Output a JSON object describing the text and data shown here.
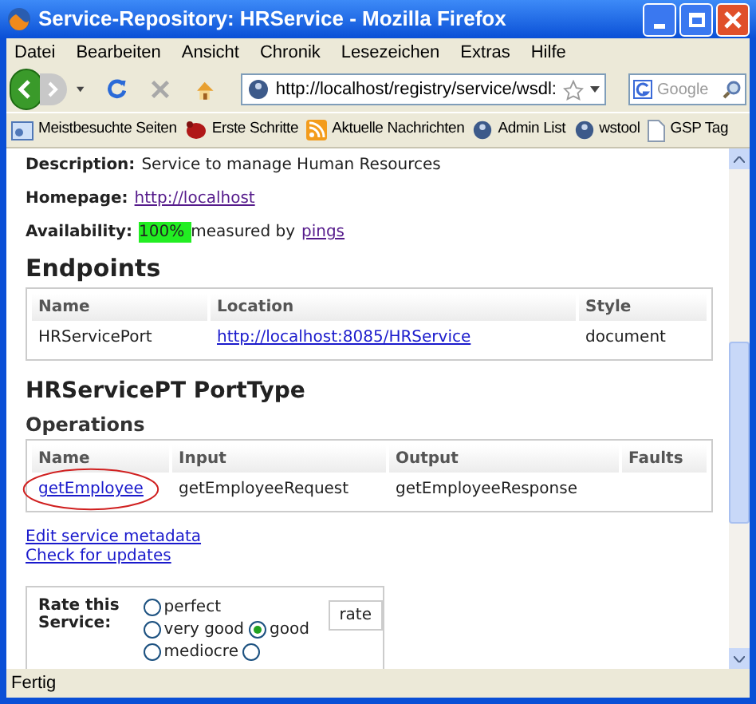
{
  "window": {
    "title": "Service-Repository: HRService - Mozilla Firefox"
  },
  "menu": [
    "Datei",
    "Bearbeiten",
    "Ansicht",
    "Chronik",
    "Lesezeichen",
    "Extras",
    "Hilfe"
  ],
  "toolbar": {
    "url": "http://localhost/registry/service/wsdl:",
    "search_placeholder": "Google"
  },
  "bookmarks": [
    {
      "label": "Meistbesuchte Seiten",
      "kind": "folder"
    },
    {
      "label": "Erste Schritte",
      "kind": "bug"
    },
    {
      "label": "Aktuelle Nachrichten",
      "kind": "feed"
    },
    {
      "label": "Admin List",
      "kind": "globe"
    },
    {
      "label": "wstool",
      "kind": "globe"
    },
    {
      "label": "GSP Tag",
      "kind": "page"
    }
  ],
  "page": {
    "description": {
      "label": "Description:",
      "value": "Service to manage Human Resources"
    },
    "homepage": {
      "label": "Homepage:",
      "link": "http://localhost"
    },
    "availability": {
      "label": "Availability:",
      "value": "100%",
      "text": "measured by",
      "link": "pings"
    },
    "endpoints": {
      "heading": "Endpoints",
      "columns": [
        "Name",
        "Location",
        "Style"
      ],
      "rows": [
        [
          "HRServicePort",
          "http://localhost:8085/HRService",
          "document"
        ]
      ]
    },
    "port_type": {
      "heading": "HRServicePT PortType",
      "subheading": "Operations",
      "columns": [
        "Name",
        "Input",
        "Output",
        "Faults"
      ],
      "rows": [
        [
          "getEmployee",
          "getEmployeeRequest",
          "getEmployeeResponse"
        ]
      ]
    },
    "links": [
      "Edit service metadata",
      "Check for updates"
    ],
    "rating": {
      "label": "Rate this Service:",
      "options": [
        {
          "label": "perfect",
          "selected": false
        },
        {
          "label": "very good",
          "selected": false
        },
        {
          "label": "good",
          "selected": true
        },
        {
          "label": "mediocre",
          "selected": false
        },
        {
          "selected": false
        }
      ],
      "button": "rate"
    }
  },
  "status_bar": "Fertig"
}
